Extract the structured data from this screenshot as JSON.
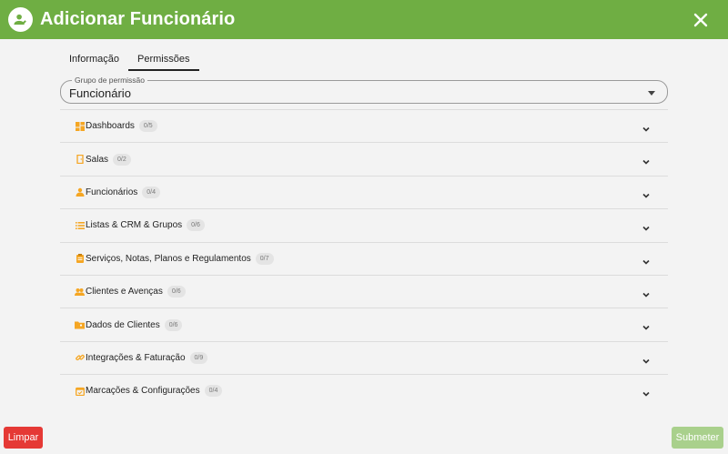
{
  "header": {
    "title": "Adicionar Funcionário",
    "logo_icon": "person-add-icon",
    "close_icon": "close-icon",
    "background": "#6fae43"
  },
  "tabs": [
    {
      "label": "Informação",
      "active": false
    },
    {
      "label": "Permissões",
      "active": true
    }
  ],
  "permission_group": {
    "legend": "Grupo de permissão",
    "value": "Funcionário"
  },
  "sections": [
    {
      "icon": "dashboard-icon",
      "label": "Dashboards",
      "count": "0/5"
    },
    {
      "icon": "door-icon",
      "label": "Salas",
      "count": "0/2"
    },
    {
      "icon": "person-icon",
      "label": "Funcionários",
      "count": "0/4"
    },
    {
      "icon": "list-icon",
      "label": "Listas & CRM & Grupos",
      "count": "0/6"
    },
    {
      "icon": "clipboard-icon",
      "label": "Serviços, Notas, Planos e Regulamentos",
      "count": "0/7"
    },
    {
      "icon": "group-icon",
      "label": "Clientes e Avenças",
      "count": "0/6"
    },
    {
      "icon": "folder-icon",
      "label": "Dados de Clientes",
      "count": "0/6"
    },
    {
      "icon": "link-icon",
      "label": "Integrações & Faturação",
      "count": "0/9"
    },
    {
      "icon": "calendar-icon",
      "label": "Marcações & Configurações",
      "count": "0/4"
    }
  ],
  "buttons": {
    "clear_label": "Limpar",
    "submit_label": "Submeter"
  },
  "colors": {
    "accent": "#6fae43",
    "icon": "#f5a623",
    "clear": "#e53935",
    "submit_disabled": "#a9d08c"
  }
}
